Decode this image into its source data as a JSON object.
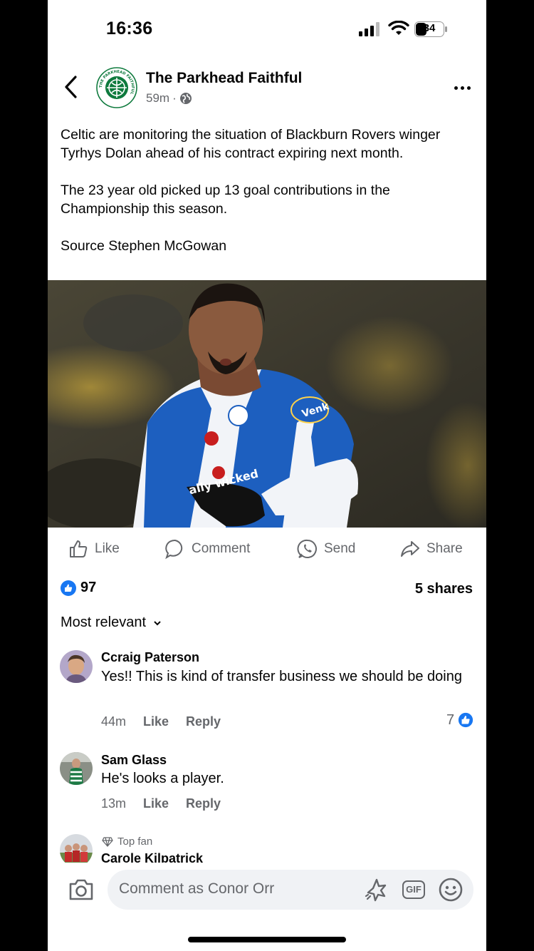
{
  "status_bar": {
    "time": "16:36",
    "battery": "34"
  },
  "post": {
    "page_name": "The Parkhead Faithful",
    "logo_ring_text": "THE PARKHEAD FAITHFUL",
    "time_ago": "59m",
    "separator": "·",
    "paragraphs": [
      "Celtic are monitoring the situation of Blackburn Rovers winger Tyrhys Dolan ahead of his contract expiring next month.",
      "The 23 year old picked up 13 goal contributions in the Championship this season.",
      "Source Stephen McGowan"
    ],
    "photo_sponsor": "Venk",
    "photo_shirt_text": "ally wicked"
  },
  "actions": {
    "like": "Like",
    "comment": "Comment",
    "send": "Send",
    "share": "Share"
  },
  "stats": {
    "reaction_count": "97",
    "shares": "5 shares"
  },
  "sort": {
    "label": "Most relevant"
  },
  "comments": [
    {
      "name": "Ccraig Paterson",
      "text": "Yes!! This is kind of transfer business we should be doing",
      "time": "44m",
      "like": "Like",
      "reply": "Reply",
      "likes": "7"
    },
    {
      "name": "Sam Glass",
      "text": "He's looks a player.",
      "time": "13m",
      "like": "Like",
      "reply": "Reply"
    },
    {
      "badge": "Top fan",
      "name": "Carole Kilpatrick"
    }
  ],
  "composer": {
    "placeholder": "Comment as Conor Orr",
    "gif": "GIF"
  },
  "colors": {
    "brand_blue": "#1877f2",
    "celtic_green": "#0e7a3d",
    "muted": "#65676b"
  }
}
